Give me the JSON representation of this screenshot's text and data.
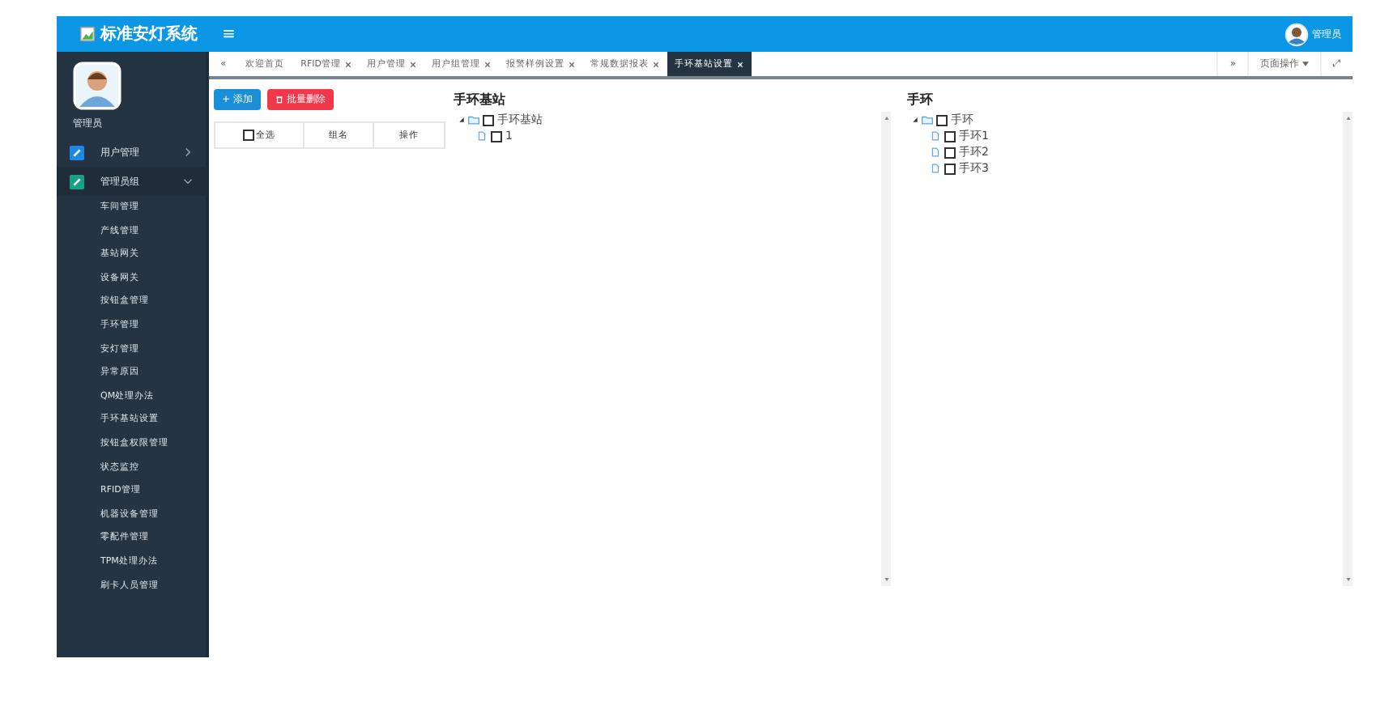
{
  "header": {
    "title": "标准安灯系统",
    "menu_glyph": "≡",
    "user": "管理员"
  },
  "sidebar": {
    "user": "管理员",
    "items": [
      {
        "label": "用户管理",
        "expanded": false,
        "color": "#1e88e5"
      },
      {
        "label": "管理员组",
        "expanded": true,
        "color": "#16a085",
        "children": [
          {
            "label": "车间管理",
            "selected": false
          },
          {
            "label": "产线管理",
            "selected": false
          },
          {
            "label": "基站网关",
            "selected": false
          },
          {
            "label": "设备网关",
            "selected": false
          },
          {
            "label": "按钮盒管理",
            "selected": false
          },
          {
            "label": "手环管理",
            "selected": false
          },
          {
            "label": "安灯管理",
            "selected": false
          },
          {
            "label": "异常原因",
            "selected": false
          },
          {
            "label": "QM处理办法",
            "selected": false
          },
          {
            "label": "手环基站设置",
            "selected": false
          },
          {
            "label": "按钮盒权限管理",
            "selected": false
          },
          {
            "label": "状态监控",
            "selected": false
          },
          {
            "label": "RFID管理",
            "selected": false
          },
          {
            "label": "机器设备管理",
            "selected": false
          },
          {
            "label": "零配件管理",
            "selected": false
          },
          {
            "label": "TPM处理办法",
            "selected": false
          },
          {
            "label": "刷卡人员管理",
            "selected": false
          }
        ]
      }
    ]
  },
  "tabs": {
    "prev": "«",
    "next": "»",
    "page_ops": "页面操作",
    "fullscreen": "⤢",
    "items": [
      {
        "label": "欢迎首页",
        "closable": false,
        "selected": false
      },
      {
        "label": "RFID管理",
        "closable": true,
        "selected": false
      },
      {
        "label": "用户管理",
        "closable": true,
        "selected": false
      },
      {
        "label": "用户组管理",
        "closable": true,
        "selected": false
      },
      {
        "label": "报警样例设置",
        "closable": true,
        "selected": false
      },
      {
        "label": "常规数据报表",
        "closable": true,
        "selected": false
      },
      {
        "label": "手环基站设置",
        "closable": true,
        "selected": true
      }
    ]
  },
  "toolbar": {
    "add": "+ 添加",
    "delete": "批量删除"
  },
  "table": {
    "select_all_checked": false,
    "columns": [
      "全选",
      "组名",
      "操作"
    ]
  },
  "trees": [
    {
      "title": "手环基站",
      "nodes": [
        {
          "label": "手环基站",
          "expanded": true,
          "checked": false,
          "children": [
            {
              "label": "1",
              "checked": false
            }
          ]
        }
      ]
    },
    {
      "title": "手环",
      "nodes": [
        {
          "label": "手环",
          "expanded": true,
          "checked": false,
          "children": [
            {
              "label": "手环1",
              "checked": false
            },
            {
              "label": "手环2",
              "checked": false
            },
            {
              "label": "手环3",
              "checked": false
            }
          ]
        }
      ]
    }
  ]
}
